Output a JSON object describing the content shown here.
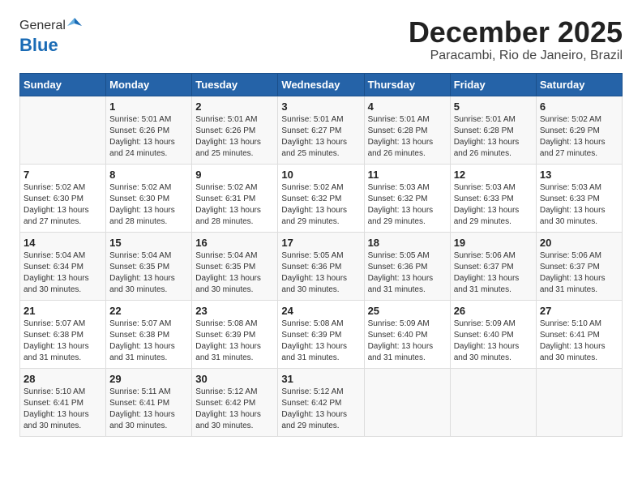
{
  "header": {
    "logo_general": "General",
    "logo_blue": "Blue",
    "month": "December 2025",
    "location": "Paracambi, Rio de Janeiro, Brazil"
  },
  "days_of_week": [
    "Sunday",
    "Monday",
    "Tuesday",
    "Wednesday",
    "Thursday",
    "Friday",
    "Saturday"
  ],
  "weeks": [
    [
      {
        "day": "",
        "sunrise": "",
        "sunset": "",
        "daylight": ""
      },
      {
        "day": "1",
        "sunrise": "5:01 AM",
        "sunset": "6:26 PM",
        "daylight": "13 hours and 24 minutes."
      },
      {
        "day": "2",
        "sunrise": "5:01 AM",
        "sunset": "6:26 PM",
        "daylight": "13 hours and 25 minutes."
      },
      {
        "day": "3",
        "sunrise": "5:01 AM",
        "sunset": "6:27 PM",
        "daylight": "13 hours and 25 minutes."
      },
      {
        "day": "4",
        "sunrise": "5:01 AM",
        "sunset": "6:28 PM",
        "daylight": "13 hours and 26 minutes."
      },
      {
        "day": "5",
        "sunrise": "5:01 AM",
        "sunset": "6:28 PM",
        "daylight": "13 hours and 26 minutes."
      },
      {
        "day": "6",
        "sunrise": "5:02 AM",
        "sunset": "6:29 PM",
        "daylight": "13 hours and 27 minutes."
      }
    ],
    [
      {
        "day": "7",
        "sunrise": "5:02 AM",
        "sunset": "6:30 PM",
        "daylight": "13 hours and 27 minutes."
      },
      {
        "day": "8",
        "sunrise": "5:02 AM",
        "sunset": "6:30 PM",
        "daylight": "13 hours and 28 minutes."
      },
      {
        "day": "9",
        "sunrise": "5:02 AM",
        "sunset": "6:31 PM",
        "daylight": "13 hours and 28 minutes."
      },
      {
        "day": "10",
        "sunrise": "5:02 AM",
        "sunset": "6:32 PM",
        "daylight": "13 hours and 29 minutes."
      },
      {
        "day": "11",
        "sunrise": "5:03 AM",
        "sunset": "6:32 PM",
        "daylight": "13 hours and 29 minutes."
      },
      {
        "day": "12",
        "sunrise": "5:03 AM",
        "sunset": "6:33 PM",
        "daylight": "13 hours and 29 minutes."
      },
      {
        "day": "13",
        "sunrise": "5:03 AM",
        "sunset": "6:33 PM",
        "daylight": "13 hours and 30 minutes."
      }
    ],
    [
      {
        "day": "14",
        "sunrise": "5:04 AM",
        "sunset": "6:34 PM",
        "daylight": "13 hours and 30 minutes."
      },
      {
        "day": "15",
        "sunrise": "5:04 AM",
        "sunset": "6:35 PM",
        "daylight": "13 hours and 30 minutes."
      },
      {
        "day": "16",
        "sunrise": "5:04 AM",
        "sunset": "6:35 PM",
        "daylight": "13 hours and 30 minutes."
      },
      {
        "day": "17",
        "sunrise": "5:05 AM",
        "sunset": "6:36 PM",
        "daylight": "13 hours and 30 minutes."
      },
      {
        "day": "18",
        "sunrise": "5:05 AM",
        "sunset": "6:36 PM",
        "daylight": "13 hours and 31 minutes."
      },
      {
        "day": "19",
        "sunrise": "5:06 AM",
        "sunset": "6:37 PM",
        "daylight": "13 hours and 31 minutes."
      },
      {
        "day": "20",
        "sunrise": "5:06 AM",
        "sunset": "6:37 PM",
        "daylight": "13 hours and 31 minutes."
      }
    ],
    [
      {
        "day": "21",
        "sunrise": "5:07 AM",
        "sunset": "6:38 PM",
        "daylight": "13 hours and 31 minutes."
      },
      {
        "day": "22",
        "sunrise": "5:07 AM",
        "sunset": "6:38 PM",
        "daylight": "13 hours and 31 minutes."
      },
      {
        "day": "23",
        "sunrise": "5:08 AM",
        "sunset": "6:39 PM",
        "daylight": "13 hours and 31 minutes."
      },
      {
        "day": "24",
        "sunrise": "5:08 AM",
        "sunset": "6:39 PM",
        "daylight": "13 hours and 31 minutes."
      },
      {
        "day": "25",
        "sunrise": "5:09 AM",
        "sunset": "6:40 PM",
        "daylight": "13 hours and 31 minutes."
      },
      {
        "day": "26",
        "sunrise": "5:09 AM",
        "sunset": "6:40 PM",
        "daylight": "13 hours and 30 minutes."
      },
      {
        "day": "27",
        "sunrise": "5:10 AM",
        "sunset": "6:41 PM",
        "daylight": "13 hours and 30 minutes."
      }
    ],
    [
      {
        "day": "28",
        "sunrise": "5:10 AM",
        "sunset": "6:41 PM",
        "daylight": "13 hours and 30 minutes."
      },
      {
        "day": "29",
        "sunrise": "5:11 AM",
        "sunset": "6:41 PM",
        "daylight": "13 hours and 30 minutes."
      },
      {
        "day": "30",
        "sunrise": "5:12 AM",
        "sunset": "6:42 PM",
        "daylight": "13 hours and 30 minutes."
      },
      {
        "day": "31",
        "sunrise": "5:12 AM",
        "sunset": "6:42 PM",
        "daylight": "13 hours and 29 minutes."
      },
      {
        "day": "",
        "sunrise": "",
        "sunset": "",
        "daylight": ""
      },
      {
        "day": "",
        "sunrise": "",
        "sunset": "",
        "daylight": ""
      },
      {
        "day": "",
        "sunrise": "",
        "sunset": "",
        "daylight": ""
      }
    ]
  ]
}
